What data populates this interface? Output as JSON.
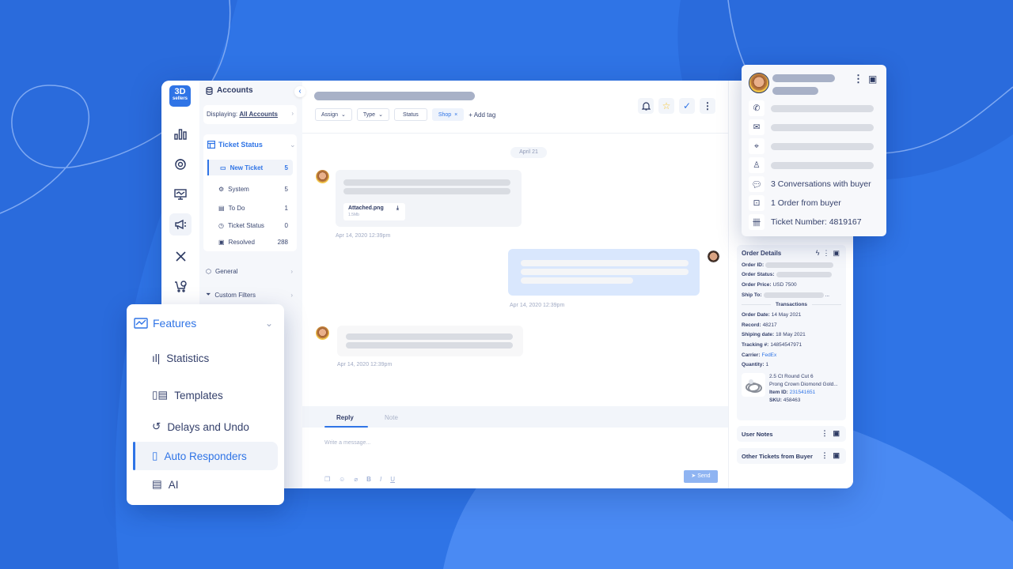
{
  "brand": {
    "logo_top": "3D",
    "logo_bottom": "sellers",
    "accent": "#2f74e6"
  },
  "rail": {
    "icons": [
      "statistics-icon",
      "support-icon",
      "monitor-icon",
      "megaphone-icon",
      "tools-icon",
      "cart-icon"
    ],
    "active": "megaphone-icon"
  },
  "accounts_panel": {
    "title": "Accounts",
    "displaying_label": "Displaying:",
    "displaying_value": "All Accounts",
    "ticket_status": {
      "title": "Ticket Status",
      "items": [
        {
          "label": "New Ticket",
          "count": "5",
          "icon": "new-ticket-icon",
          "active": true
        },
        {
          "label": "System",
          "count": "5",
          "icon": "gear-icon"
        },
        {
          "label": "To Do",
          "count": "1",
          "icon": "clipboard-icon"
        },
        {
          "label": "Ticket Status",
          "count": "0",
          "icon": "clock-icon"
        },
        {
          "label": "Resolved",
          "count": "288",
          "icon": "resolved-icon"
        }
      ]
    },
    "links": [
      {
        "label": "General",
        "icon": "cube-icon"
      },
      {
        "label": "Custom Filters",
        "icon": "filter-icon"
      }
    ]
  },
  "ticket": {
    "chips": [
      {
        "label": "Assign",
        "type": "dropdown"
      },
      {
        "label": "Type",
        "type": "dropdown"
      },
      {
        "label": "Status",
        "type": "button"
      },
      {
        "label": "Shop",
        "type": "tag"
      }
    ],
    "add_tag": "+ Add tag",
    "actions": [
      "bell-icon",
      "star-icon",
      "check-icon",
      "more-icon"
    ],
    "date_separator": "April 21",
    "messages": [
      {
        "from": "buyer",
        "attachment": {
          "name": "Attached.png",
          "size": "1.5Mb"
        },
        "timestamp": "Apr 14, 2020 12:39pm"
      },
      {
        "from": "agent",
        "timestamp": "Apr 14, 2020 12:39pm"
      },
      {
        "from": "buyer",
        "timestamp": "Apr 14, 2020 12:39pm"
      }
    ],
    "composer": {
      "tabs": [
        "Reply",
        "Note"
      ],
      "active_tab": "Reply",
      "placeholder": "Write a message...",
      "format_buttons": [
        "template-icon",
        "emoji-icon",
        "attach-icon",
        "B",
        "I",
        "U"
      ],
      "send": "Send"
    }
  },
  "order_details": {
    "title": "Order Details",
    "order_id_label": "Order ID:",
    "order_status_label": "Order Status:",
    "order_price_label": "Order Price:",
    "order_price": "USD 7500",
    "ship_to_label": "Ship To:",
    "ship_to_suffix": "...",
    "transactions_label": "Transactions",
    "order_date_label": "Order Date:",
    "order_date": "14 May 2021",
    "record_label": "Record:",
    "record": "48217",
    "shipping_date_label": "Shiping date:",
    "shipping_date": "18 May 2021",
    "tracking_label": "Tracking #:",
    "tracking": "14854547971",
    "carrier_label": "Carrier:",
    "carrier": "FedEx",
    "quantity_label": "Quantity:",
    "quantity": "1",
    "product": {
      "name_line1": "2.5 Ct Round Cut 6",
      "name_line2": "Prong Crown Diomond Gold...",
      "item_id_label": "Item ID:",
      "item_id": "231541651",
      "sku_label": "SKU:",
      "sku": "458463"
    }
  },
  "user_notes": "User Notes",
  "other_tickets": "Other Tickets from Buyer",
  "buyer_card": {
    "conversations": "3 Conversations with buyer",
    "orders": "1 Order from buyer",
    "ticket_number": "Ticket Number: 4819167"
  },
  "features": {
    "title": "Features",
    "items": [
      {
        "label": "Statistics",
        "icon": "statistics-icon"
      },
      {
        "label": "Templates",
        "icon": "templates-icon"
      },
      {
        "label": "Delays and Undo",
        "icon": "undo-timer-icon"
      },
      {
        "label": "Auto Responders",
        "icon": "auto-responder-icon",
        "active": true
      },
      {
        "label": "AI",
        "icon": "ai-icon"
      }
    ]
  }
}
